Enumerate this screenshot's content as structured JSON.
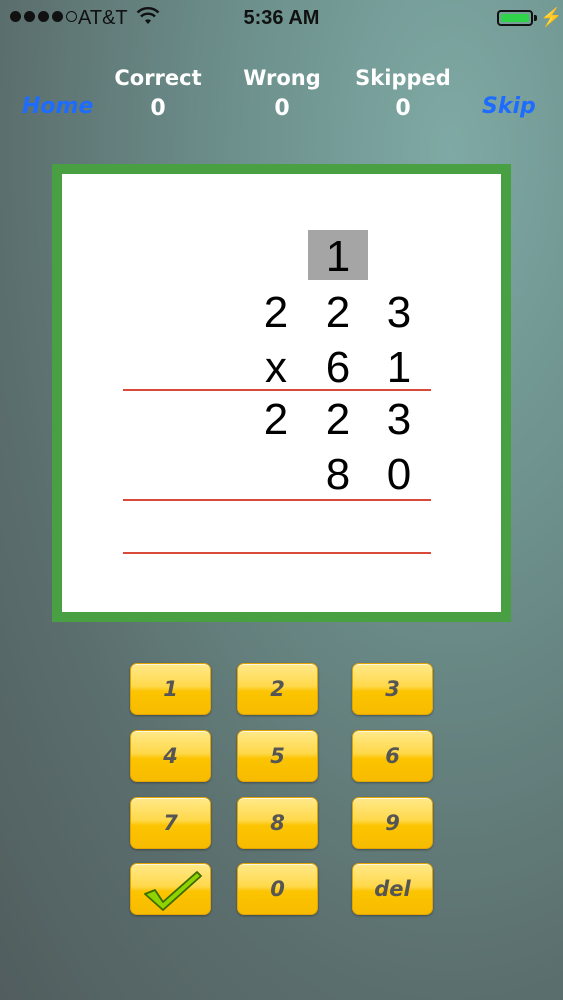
{
  "status_bar": {
    "carrier": "AT&T",
    "time": "5:36 AM",
    "signal_bars": 4,
    "battery_level": 1.0,
    "charging": true
  },
  "header": {
    "home_label": "Home",
    "skip_label": "Skip",
    "scores": {
      "correct_label": "Correct",
      "correct_value": "0",
      "wrong_label": "Wrong",
      "wrong_value": "0",
      "skipped_label": "Skipped",
      "skipped_value": "0"
    }
  },
  "problem": {
    "carry": "1",
    "multiplicand": [
      "2",
      "2",
      "3"
    ],
    "operator": "x",
    "multiplier": [
      "6",
      "1"
    ],
    "partial_product_1": [
      "2",
      "2",
      "3"
    ],
    "partial_product_2": [
      "8",
      "0"
    ]
  },
  "keypad": {
    "keys": [
      "1",
      "2",
      "3",
      "4",
      "5",
      "6",
      "7",
      "8",
      "9",
      "0"
    ],
    "delete_label": "del",
    "submit_icon": "checkmark-icon"
  },
  "colors": {
    "board_border": "#49a043",
    "link": "#1d6cff",
    "rule": "#d94a3a",
    "key": "#fcc400"
  }
}
